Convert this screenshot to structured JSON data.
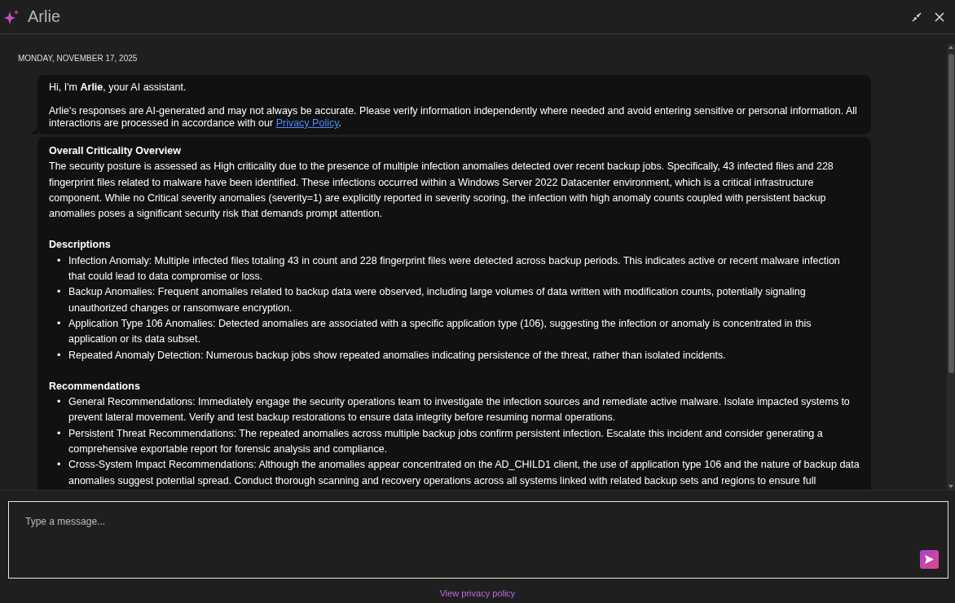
{
  "header": {
    "title": "Arlie"
  },
  "date": "MONDAY, NOVEMBER 17, 2025",
  "greeting": {
    "lines": [
      "Hi, I'm **Arlie**, your AI assistant."
    ],
    "disclaimer": "Arlie's responses are AI-generated and may not always be accurate. Please verify information independently where needed and avoid entering sensitive or personal information. All interactions are processed in accordance with our",
    "link": "Privacy Policy",
    "after_link": "."
  },
  "report": {
    "bullet_marker": "•",
    "sections": [
      {
        "heading": "Overall Criticality Overview",
        "paragraph": "The security posture is assessed as High criticality due to the presence of multiple infection anomalies detected over recent backup jobs. Specifically, 43 infected files and 228 fingerprint files related to malware have been identified. These infections occurred within a Windows Server 2022 Datacenter environment, which is a critical infrastructure component. While no Critical severity anomalies (severity=1) are explicitly reported in severity scoring, the infection with high anomaly counts coupled with persistent backup anomalies poses a significant security risk that demands prompt attention."
      },
      {
        "heading": "Descriptions",
        "bullets": [
          "Infection Anomaly: Multiple infected files totaling 43 in count and 228 fingerprint files were detected across backup periods. This indicates active or recent malware infection that could lead to data compromise or loss.",
          "Backup Anomalies: Frequent anomalies related to backup data were observed, including large volumes of data written with modification counts, potentially signaling unauthorized changes or ransomware encryption.",
          "Application Type 106 Anomalies: Detected anomalies are associated with a specific application type (106), suggesting the infection or anomaly is concentrated in this application or its data subset.",
          "Repeated Anomaly Detection: Numerous backup jobs show repeated anomalies indicating persistence of the threat, rather than isolated incidents."
        ]
      },
      {
        "heading": "Recommendations",
        "bullets": [
          "General Recommendations: Immediately engage the security operations team to investigate the infection sources and remediate active malware. Isolate impacted systems to prevent lateral movement. Verify and test backup restorations to ensure data integrity before resuming normal operations.",
          "Persistent Threat Recommendations: The repeated anomalies across multiple backup jobs confirm persistent infection. Escalate this incident and consider generating a comprehensive exportable report for forensic analysis and compliance.",
          "Cross-System Impact Recommendations: Although the anomalies appear concentrated on the AD_CHILD1 client, the use of application type 106 and the nature of backup data anomalies suggest potential spread. Conduct thorough scanning and recovery operations across all systems linked with related backup sets and regions to ensure full"
        ]
      }
    ]
  },
  "composer": {
    "placeholder": "Type a message..."
  },
  "footer_link": "View privacy policy"
}
